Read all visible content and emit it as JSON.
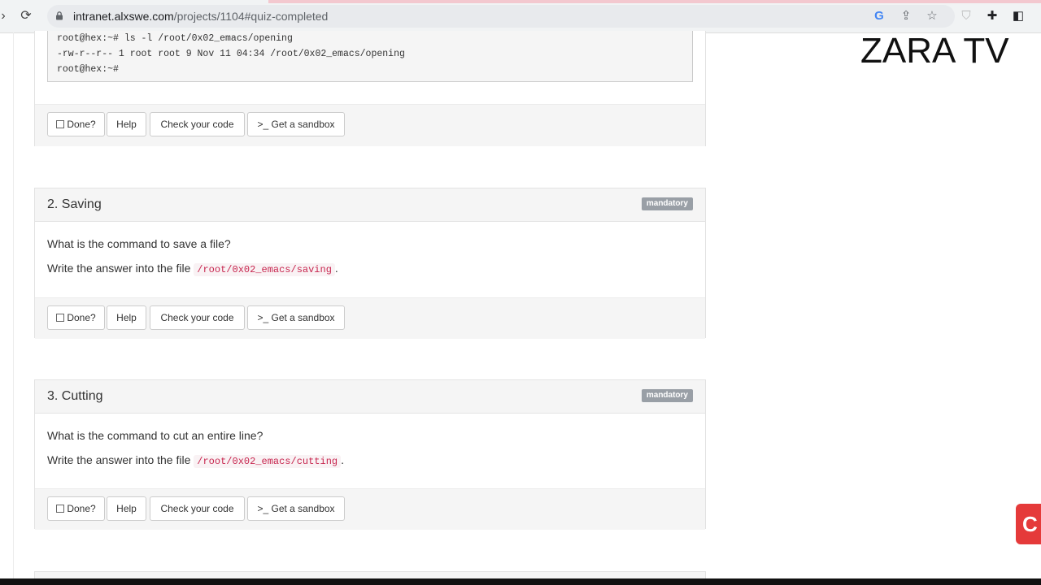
{
  "browser": {
    "url_host": "intranet.alxswe.com",
    "url_path": "/projects/1104#quiz-completed"
  },
  "watermark": "ZARA TV",
  "terminal": {
    "lines": [
      "root@hex:~# ls -l /root/0x02_emacs/opening",
      "-rw-r--r-- 1 root root 9 Nov 11 04:34 /root/0x02_emacs/opening",
      "root@hex:~#"
    ]
  },
  "buttons": {
    "done": "Done?",
    "help": "Help",
    "check": "Check your code",
    "sandbox": "Get a sandbox",
    "sandbox_prefix": ">_"
  },
  "tasks": [
    {
      "title": "2. Saving",
      "badge": "mandatory",
      "question": "What is the command to save a file?",
      "answer_prefix": "Write the answer into the file",
      "file": "/root/0x02_emacs/saving",
      "suffix": "."
    },
    {
      "title": "3. Cutting",
      "badge": "mandatory",
      "question": "What is the command to cut an entire line?",
      "answer_prefix": "Write the answer into the file",
      "file": "/root/0x02_emacs/cutting",
      "suffix": "."
    }
  ],
  "colors": {
    "badge": "#999fa6",
    "code_text": "#c7254e",
    "panel_bg": "#f5f5f5"
  }
}
